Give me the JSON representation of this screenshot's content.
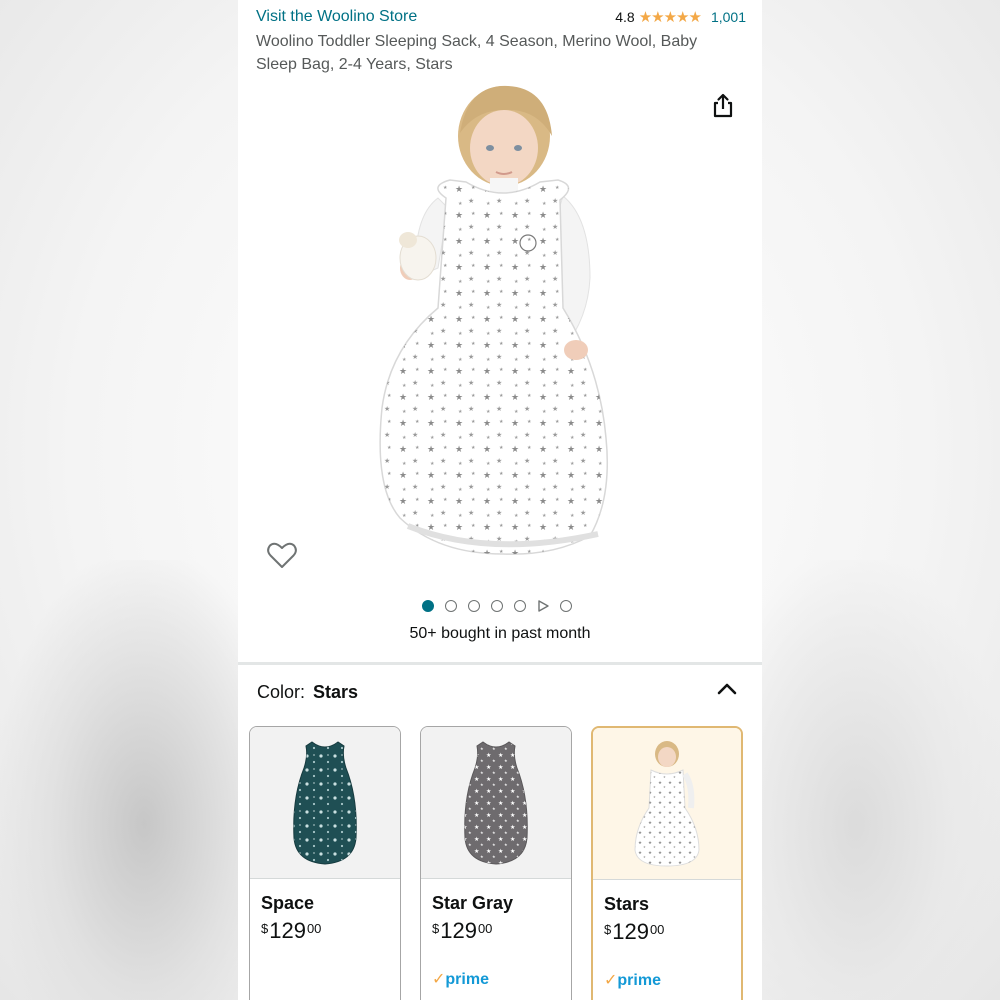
{
  "store": {
    "link_text": "Visit the Woolino Store",
    "rating": "4.8",
    "stars": "★★★★★",
    "review_count": "1,001"
  },
  "product": {
    "title": "Woolino Toddler Sleeping Sack, 4 Season, Merino Wool, Baby Sleep Bag, 2-4 Years, Stars",
    "bought_text": "50+ bought in past month"
  },
  "carousel": {
    "total_items": 7,
    "active_index": 0,
    "video_index": 5
  },
  "color_selector": {
    "label": "Color:",
    "value": "Stars"
  },
  "variants": [
    {
      "name": "Space",
      "currency": "$",
      "price_whole": "129",
      "price_cents": "00",
      "prime": false,
      "selected": false
    },
    {
      "name": "Star Gray",
      "currency": "$",
      "price_whole": "129",
      "price_cents": "00",
      "prime": true,
      "prime_label": "prime",
      "selected": false
    },
    {
      "name": "Stars",
      "currency": "$",
      "price_whole": "129",
      "price_cents": "00",
      "prime": true,
      "prime_label": "prime",
      "selected": true
    }
  ],
  "colors": {
    "link": "#007185",
    "star": "#f3a847",
    "prime": "#1399d6",
    "selected_border": "#e0b872",
    "space_fabric": "#1f4f54",
    "gray_fabric": "#6e6b6e"
  },
  "icons": {
    "share": "share-icon",
    "wishlist": "heart-icon",
    "collapse": "chevron-up-icon",
    "play": "play-icon"
  }
}
